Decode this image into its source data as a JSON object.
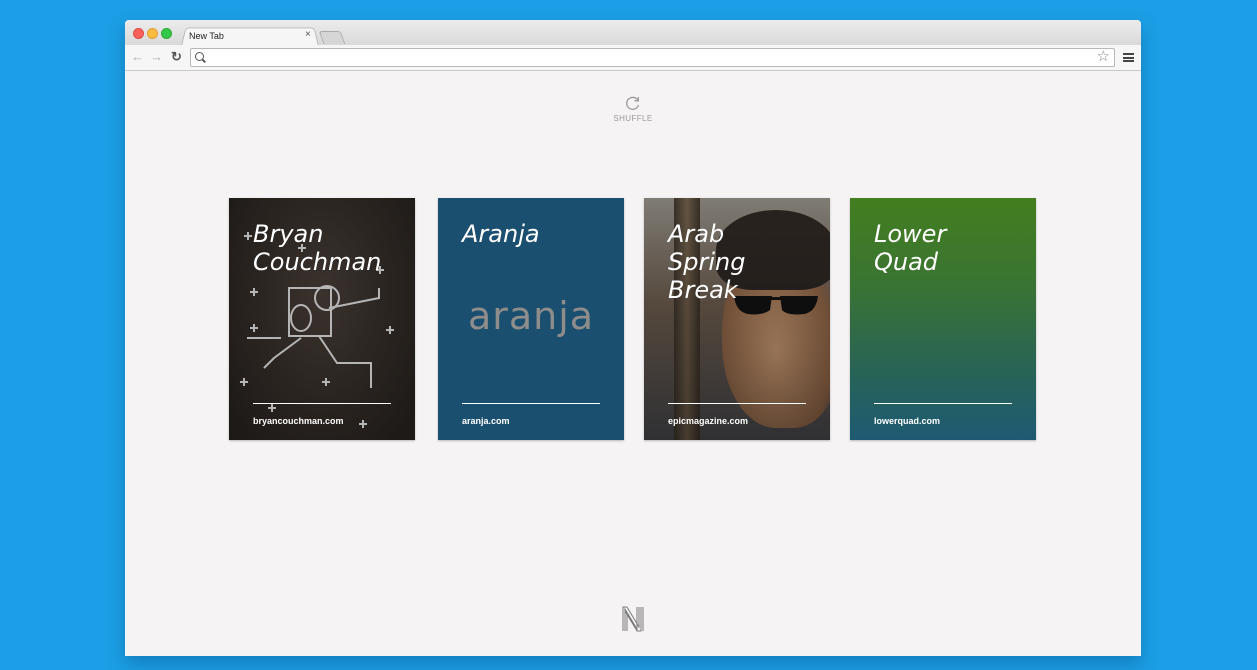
{
  "browser": {
    "tab_title": "New Tab",
    "tab_close": "×",
    "address_value": "",
    "nav": {
      "back": "←",
      "forward": "→",
      "reload": "↻"
    },
    "star": "☆"
  },
  "shuffle": {
    "label": "SHUFFLE"
  },
  "cards": [
    {
      "title": "Bryan\nCouchman",
      "url": "bryancouchman.com"
    },
    {
      "title": "Aranja",
      "url": "aranja.com",
      "logo_text": "aranja"
    },
    {
      "title": "Arab\nSpring\nBreak",
      "url": "epicmagazine.com"
    },
    {
      "title": "Lower\nQuad",
      "url": "lowerquad.com"
    }
  ],
  "colors": {
    "background": "#1c9fe6",
    "page": "#f5f3f4",
    "aranja": "#1b4f70",
    "lowerquad_top": "#437e1f",
    "lowerquad_bottom": "#1d5a72"
  }
}
